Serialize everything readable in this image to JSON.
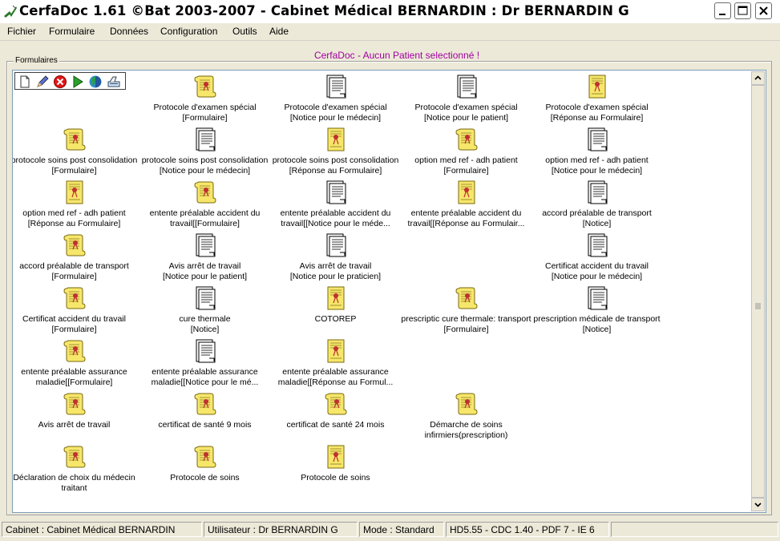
{
  "window": {
    "title": "CerfaDoc 1.61 ©Bat 2003-2007  - Cabinet Médical BERNARDIN : Dr BERNARDIN G",
    "app_icon": "cerfadoc-app-icon"
  },
  "menu": [
    "Fichier",
    "Formulaire",
    "Données",
    "Configuration",
    "Outils",
    "Aide"
  ],
  "status_message": "CerfaDoc - Aucun Patient selectionné !",
  "group_label": "Formulaires",
  "toolbar": [
    "new-document-icon",
    "edit-pen-icon",
    "delete-red-x-icon",
    "play-green-arrow-icon",
    "globe-icon",
    "scanner-icon"
  ],
  "items": [
    {
      "line1": "Protocole d'examen spécial",
      "line2": "[Formulaire]",
      "icon": "scroll"
    },
    {
      "line1": "Protocole d'examen spécial",
      "line2": "[Notice pour le médecin]",
      "icon": "notice"
    },
    {
      "line1": "Protocole d'examen spécial",
      "line2": "[Notice pour le patient]",
      "icon": "notice"
    },
    {
      "line1": "Protocole d'examen spécial",
      "line2": "[Réponse au Formulaire]",
      "icon": "reply"
    },
    {
      "line1": "protocole soins post consolidation",
      "line2": "[Formulaire]",
      "icon": "scroll"
    },
    {
      "line1": "protocole soins post consolidation",
      "line2": "[Notice pour le médecin]",
      "icon": "notice"
    },
    {
      "line1": "protocole soins post consolidation",
      "line2": "[Réponse au Formulaire]",
      "icon": "reply"
    },
    {
      "line1": "option med ref - adh patient",
      "line2": "[Formulaire]",
      "icon": "scroll"
    },
    {
      "line1": "option med ref - adh patient",
      "line2": "[Notice pour le médecin]",
      "icon": "notice"
    },
    {
      "line1": "option med ref - adh patient",
      "line2": "[Réponse au Formulaire]",
      "icon": "reply"
    },
    {
      "line1": "entente préalable accident du",
      "line2": "travail[[Formulaire]",
      "icon": "scroll"
    },
    {
      "line1": "entente préalable accident du",
      "line2": "travail[[Notice pour le méde...",
      "icon": "notice"
    },
    {
      "line1": "entente préalable accident du",
      "line2": "travail[[Réponse au Formulair...",
      "icon": "reply"
    },
    {
      "line1": "accord préalable de transport",
      "line2": "[Notice]",
      "icon": "notice"
    },
    {
      "line1": "accord préalable de transport",
      "line2": "[Formulaire]",
      "icon": "scroll"
    },
    {
      "line1": "Avis arrêt de travail",
      "line2": "[Notice pour le patient]",
      "icon": "notice"
    },
    {
      "line1": "Avis arrêt de travail",
      "line2": "[Notice pour le praticien]",
      "icon": "notice"
    },
    {
      "line1": "Certificat accident du travail",
      "line2": "[Notice pour le médecin]",
      "icon": "notice"
    },
    {
      "line1": "Certificat accident du travail",
      "line2": "[Formulaire]",
      "icon": "scroll"
    },
    {
      "line1": "cure thermale",
      "line2": "[Notice]",
      "icon": "notice"
    },
    {
      "line1": "COTOREP",
      "line2": "",
      "icon": "reply"
    },
    {
      "line1": "prescriptic cure thermale: transport",
      "line2": "[Formulaire]",
      "icon": "scroll"
    },
    {
      "line1": "prescription médicale de transport",
      "line2": "[Notice]",
      "icon": "notice"
    },
    {
      "line1": "entente préalable assurance",
      "line2": "maladie[[Formulaire]",
      "icon": "scroll"
    },
    {
      "line1": "entente préalable assurance",
      "line2": "maladie[[Notice pour le mé...",
      "icon": "notice"
    },
    {
      "line1": "entente préalable assurance",
      "line2": "maladie[[Réponse au Formul...",
      "icon": "reply"
    },
    {
      "line1": "Avis arrêt de travail",
      "line2": "",
      "icon": "scroll"
    },
    {
      "line1": "certificat de santé 9 mois",
      "line2": "",
      "icon": "scroll"
    },
    {
      "line1": "certificat de santé 24 mois",
      "line2": "",
      "icon": "scroll"
    },
    {
      "line1": "Démarche de soins",
      "line2": "infirmiers(prescription)",
      "icon": "scroll"
    },
    {
      "line1": "Déclaration de choix du médecin",
      "line2": "traitant",
      "icon": "scroll"
    },
    {
      "line1": "Protocole de soins",
      "line2": "",
      "icon": "scroll"
    },
    {
      "line1": "Protocole de soins",
      "line2": "",
      "icon": "reply"
    }
  ],
  "statusbar": {
    "cabinet": "Cabinet : Cabinet Médical BERNARDIN",
    "user": "Utilisateur : Dr BERNARDIN G",
    "mode": "Mode : Standard",
    "versions": "HD5.55 - CDC 1.40 - PDF 7 - IE 6"
  }
}
